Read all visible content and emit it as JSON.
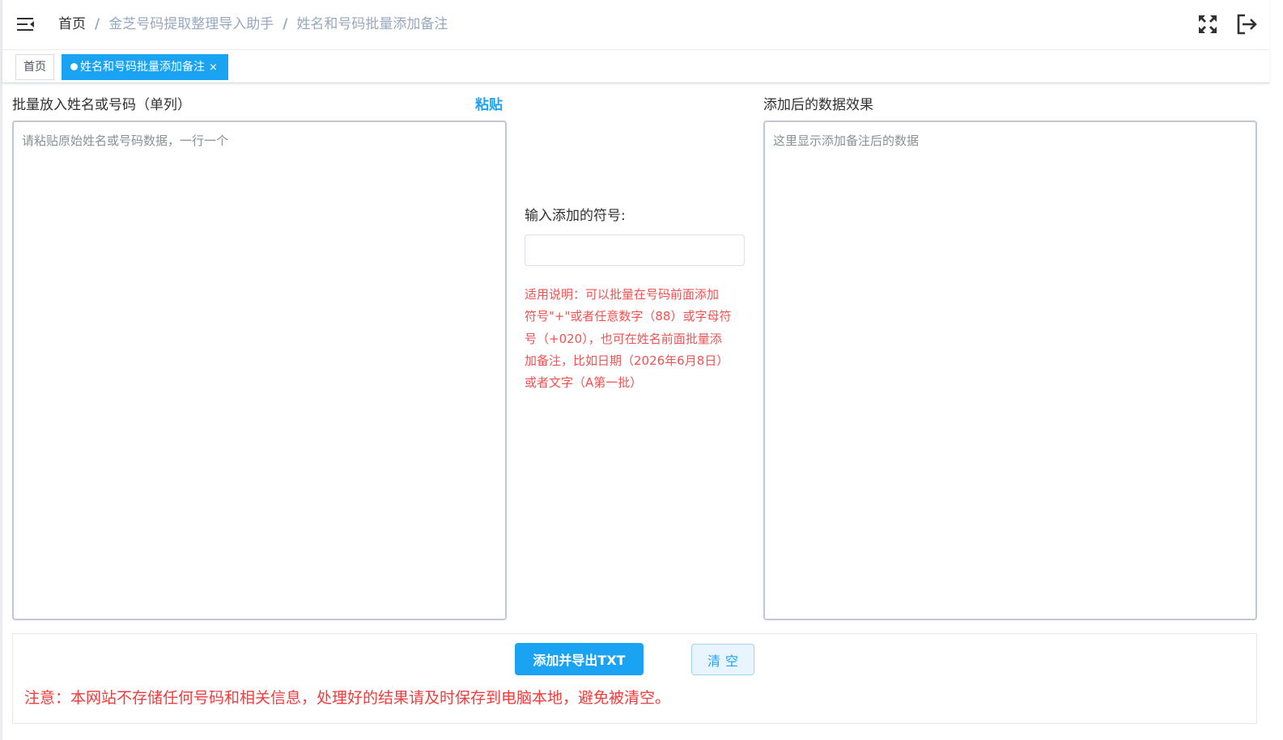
{
  "navbar": {
    "breadcrumb": {
      "home": "首页",
      "separator": "/",
      "level1": "金芝号码提取整理导入助手",
      "level2": "姓名和号码批量添加备注"
    },
    "icons": [
      "menu-fold-icon",
      "fullscreen-icon",
      "logout-icon"
    ]
  },
  "tags": {
    "home": "首页",
    "active": "姓名和号码批量添加备注",
    "close": "×"
  },
  "left_panel": {
    "label": "批量放入姓名或号码（单列）",
    "paste_link": "粘贴",
    "placeholder": "请粘贴原始姓名或号码数据，一行一个",
    "value": ""
  },
  "middle_panel": {
    "label": "输入添加的符号:",
    "input_value": "",
    "note_lines": [
      "适用说明：可以批量在号码前面添加",
      "符号\"+\"或者任意数字（88）或字母符",
      "号（+020），也可在姓名前面批量添",
      "加备注，比如日期（2026年6月8日）",
      "或者文字（A第一批）"
    ]
  },
  "right_panel": {
    "label": "添加后的数据效果",
    "placeholder": "这里显示添加备注后的数据",
    "value": ""
  },
  "bottom": {
    "primary_button": "添加并导出TXT",
    "clear_button": "清空",
    "warning": "注意：本网站不存储任何号码和相关信息，处理好的结果请及时保存到电脑本地，避免被清空。"
  },
  "colors": {
    "accent": "#1ba3f3",
    "breadcrumb_link": "#97a8be",
    "warning_red": "#f03c3c",
    "note_red": "#f05252"
  }
}
